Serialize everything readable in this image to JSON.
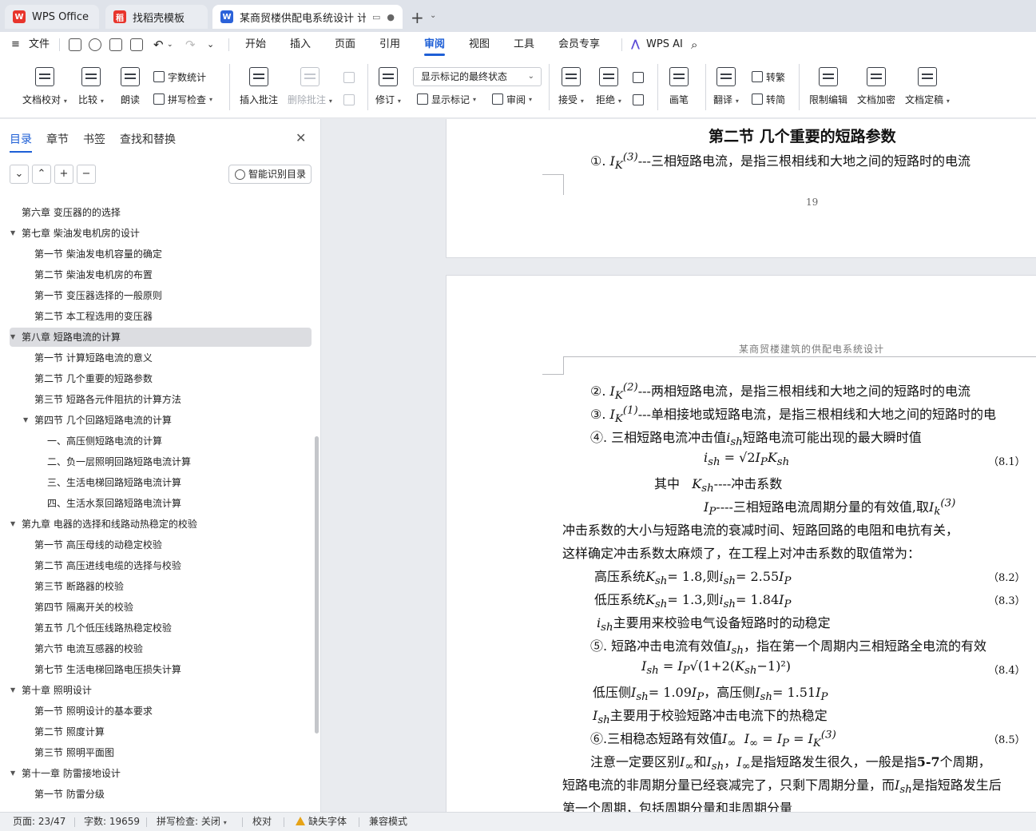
{
  "tabs": [
    {
      "label": "WPS Office",
      "icon": "wps-logo-icon",
      "color": "#e8352c"
    },
    {
      "label": "找稻壳模板",
      "icon": "docer-icon",
      "color": "#e8352c"
    },
    {
      "label": "某商贸楼供配电系统设计 计算",
      "icon": "word-doc-icon",
      "color": "#2b62d9"
    }
  ],
  "menu": {
    "file": "文件",
    "items": [
      "开始",
      "插入",
      "页面",
      "引用",
      "审阅",
      "视图",
      "工具",
      "会员专享"
    ],
    "active": "审阅",
    "ai": "WPS AI"
  },
  "ribbon": {
    "doc_check": "文档校对",
    "compare": "比较",
    "read_aloud": "朗读",
    "word_count": "字数统计",
    "spell_check": "拼写检查",
    "insert_comment": "插入批注",
    "delete_comment": "删除批注",
    "track_changes": "修订",
    "markup_state": "显示标记的最终状态",
    "show_markup": "显示标记",
    "review_pane": "审阅",
    "accept": "接受",
    "reject": "拒绝",
    "pen": "画笔",
    "translate": "翻译",
    "to_traditional": "转繁",
    "to_simplified": "转简",
    "restrict_edit": "限制编辑",
    "encrypt": "文档加密",
    "finalize": "文档定稿"
  },
  "nav": {
    "tabs": [
      "目录",
      "章节",
      "书签",
      "查找和替换"
    ],
    "smart_toc": "智能识别目录",
    "items": [
      {
        "label": "第六章  变压器的的选择",
        "level": 1,
        "arrow": ""
      },
      {
        "label": "第七章  柴油发电机房的设计",
        "level": 1,
        "arrow": "▼"
      },
      {
        "label": "第一节  柴油发电机容量的确定",
        "level": 2,
        "arrow": ""
      },
      {
        "label": "第二节  柴油发电机房的布置",
        "level": 2,
        "arrow": ""
      },
      {
        "label": "第一节  变压器选择的一般原则",
        "level": 2,
        "arrow": ""
      },
      {
        "label": "第二节  本工程选用的变压器",
        "level": 2,
        "arrow": ""
      },
      {
        "label": "第八章  短路电流的计算",
        "level": 1,
        "arrow": "▼",
        "selected": true
      },
      {
        "label": "第一节  计算短路电流的意义",
        "level": 2,
        "arrow": ""
      },
      {
        "label": "第二节  几个重要的短路参数",
        "level": 2,
        "arrow": ""
      },
      {
        "label": "第三节  短路各元件阻抗的计算方法",
        "level": 2,
        "arrow": ""
      },
      {
        "label": "第四节  几个回路短路电流的计算",
        "level": 2,
        "arrow": "▼"
      },
      {
        "label": "一、高压侧短路电流的计算",
        "level": 3,
        "arrow": ""
      },
      {
        "label": "二、负一层照明回路短路电流计算",
        "level": 3,
        "arrow": ""
      },
      {
        "label": "三、生活电梯回路短路电流计算",
        "level": 3,
        "arrow": ""
      },
      {
        "label": "四、生活水泵回路短路电流计算",
        "level": 3,
        "arrow": ""
      },
      {
        "label": "第九章  电器的选择和线路动热稳定的校验",
        "level": 1,
        "arrow": "▼"
      },
      {
        "label": "第一节  高压母线的动稳定校验",
        "level": 2,
        "arrow": ""
      },
      {
        "label": "第二节  高压进线电缆的选择与校验",
        "level": 2,
        "arrow": ""
      },
      {
        "label": "第三节  断路器的校验",
        "level": 2,
        "arrow": ""
      },
      {
        "label": "第四节  隔离开关的校验",
        "level": 2,
        "arrow": ""
      },
      {
        "label": "第五节  几个低压线路热稳定校验",
        "level": 2,
        "arrow": ""
      },
      {
        "label": "第六节  电流互感器的校验",
        "level": 2,
        "arrow": ""
      },
      {
        "label": "第七节  生活电梯回路电压损失计算",
        "level": 2,
        "arrow": ""
      },
      {
        "label": "第十章  照明设计",
        "level": 1,
        "arrow": "▼"
      },
      {
        "label": "第一节  照明设计的基本要求",
        "level": 2,
        "arrow": ""
      },
      {
        "label": "第二节  照度计算",
        "level": 2,
        "arrow": ""
      },
      {
        "label": "第三节  照明平面图",
        "level": 2,
        "arrow": ""
      },
      {
        "label": "第十一章  防雷接地设计",
        "level": 1,
        "arrow": "▼"
      },
      {
        "label": "第一节  防雷分级",
        "level": 2,
        "arrow": ""
      }
    ]
  },
  "doc": {
    "section_title": "第二节  几个重要的短路参数",
    "item1_prefix": "①.",
    "item1_text": "---三相短路电流，是指三根相线和大地之间的短路时的电流",
    "page_number": "19",
    "header_text": "某商贸楼建筑的供配电系统设计",
    "item2_prefix": "②.",
    "item2_text": "---两相短路电流，是指三根相线和大地之间的短路时的电流",
    "item3_prefix": "③.",
    "item3_text": "---单相接地或短路电流，是指三根相线和大地之间的短路时的电",
    "item4_a": "④. 三相短路电流冲击值",
    "item4_b": "短路电流可能出现的最大瞬时值",
    "eq1_no": "（8.1）",
    "where_label": "其中",
    "ksh_desc": "----冲击系数",
    "ip_desc": "----三相短路电流周期分量的有效值,取",
    "para1": "冲击系数的大小与短路电流的衰减时间、短路回路的电阻和电抗有关，",
    "para2": "这样确定冲击系数太麻烦了，在工程上对冲击系数的取值常为：",
    "hv_label": "高压系统",
    "hv_eq": "= 1.8,则",
    "hv_eq2": "= 2.55",
    "eq2_no": "（8.2）",
    "lv_label": "低压系统",
    "lv_eq": "= 1.3,则",
    "lv_eq2": "= 1.84",
    "eq3_no": "（8.3）",
    "ish_use": "主要用来校验电气设备短路时的动稳定",
    "item5_a": "⑤. 短路冲击电流有效值",
    "item5_b": "，指在第一个周期内三相短路全电流的有效",
    "eq4_no": "（8.4）",
    "lv_side": "低压侧",
    "lv_side_val": "= 1.09",
    "hv_side": "，高压侧",
    "hv_side_val": "= 1.51",
    "Ish_use": "主要用于校验短路冲击电流下的热稳定",
    "item6": "⑥.三相稳态短路有效值",
    "eq5_no": "（8.5）",
    "note1_a": "注意一定要区别",
    "note1_b": "和",
    "note1_c": "，",
    "note1_d": "是指短路发生很久，一般是指",
    "note1_e": "5-7",
    "note1_f": "个周期，",
    "note2_a": "短路电流的非周期分量已经衰减完了，只剩下周期分量，而",
    "note2_b": "是指短路发生后",
    "note3": "第一个周期，包括周期分量和非周期分量"
  },
  "status": {
    "page": "页面: 23/47",
    "words": "字数: 19659",
    "spell": "拼写检查: 关闭",
    "proof": "校对",
    "missing_font": "缺失字体",
    "compat": "兼容模式"
  }
}
